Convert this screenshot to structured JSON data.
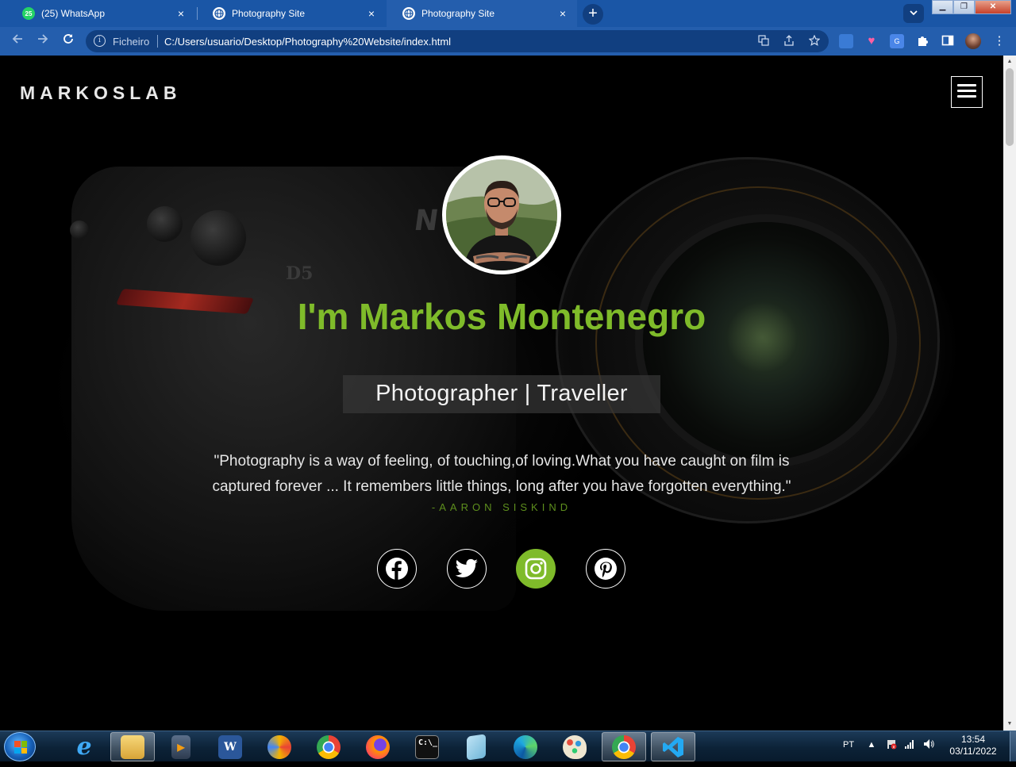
{
  "browser": {
    "tabs": [
      {
        "title": "(25) WhatsApp",
        "badge": "25",
        "active": false
      },
      {
        "title": "Photography Site",
        "active": false
      },
      {
        "title": "Photography Site",
        "active": true
      }
    ],
    "tab_close": "×",
    "new_tab": "+",
    "address": {
      "scheme_label": "Ficheiro",
      "url": "C:/Users/usuario/Desktop/Photography%20Website/index.html"
    }
  },
  "page": {
    "brand": "MARKOSLAB",
    "headline": "I'm Markos Montenegro",
    "subtitle": "Photographer | Traveller",
    "quote_line1": "\"Photography is a way of feeling, of touching,of loving.What you have caught on film is",
    "quote_line2": "captured forever ... It remembers little things, long after you have forgotten everything.\"",
    "author": "-AARON SISKIND",
    "background_text": {
      "brand_mark": "N",
      "model_mark": "D5"
    },
    "social": [
      {
        "name": "facebook",
        "icon": "facebook-icon",
        "active": false
      },
      {
        "name": "twitter",
        "icon": "twitter-icon",
        "active": false
      },
      {
        "name": "instagram",
        "icon": "instagram-icon",
        "active": true
      },
      {
        "name": "pinterest",
        "icon": "pinterest-icon",
        "active": false
      }
    ],
    "colors": {
      "accent": "#7fbb2a",
      "background": "#000000",
      "text": "#e6e6e6"
    }
  },
  "taskbar": {
    "language": "PT",
    "time": "13:54",
    "date": "03/11/2022",
    "apps": [
      "internet-explorer",
      "file-explorer",
      "media-player",
      "word",
      "vpn",
      "chrome",
      "firefox",
      "command-prompt",
      "notepad",
      "edge",
      "paint",
      "chrome-active",
      "vscode"
    ]
  }
}
